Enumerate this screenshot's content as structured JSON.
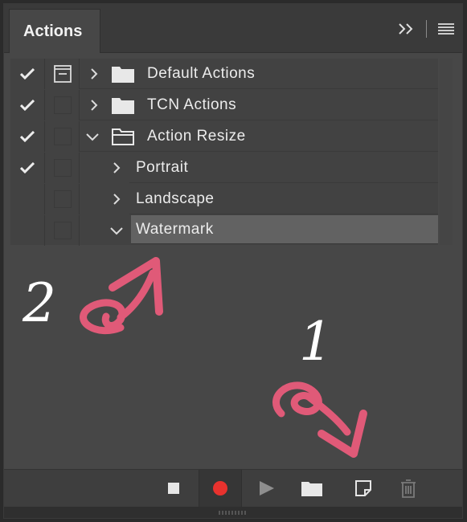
{
  "panel": {
    "tab_title": "Actions",
    "controls": {
      "collapse_icon": "double-chevron-right-icon",
      "menu_icon": "hamburger-menu-icon"
    }
  },
  "rows": [
    {
      "label": "Default Actions",
      "checked": true,
      "dialog": true,
      "expanded": false,
      "type": "set"
    },
    {
      "label": "TCN Actions",
      "checked": true,
      "dialog": false,
      "expanded": false,
      "type": "set"
    },
    {
      "label": "Action Resize",
      "checked": true,
      "dialog": false,
      "expanded": true,
      "type": "set"
    },
    {
      "label": "Portrait",
      "checked": true,
      "dialog": false,
      "expanded": false,
      "type": "action"
    },
    {
      "label": "Landscape",
      "checked": false,
      "dialog": false,
      "expanded": false,
      "type": "action"
    },
    {
      "label": "Watermark",
      "checked": false,
      "dialog": false,
      "expanded": true,
      "type": "action",
      "selected": true
    }
  ],
  "toolbar": {
    "buttons": [
      "stop-icon",
      "record-icon",
      "play-icon",
      "new-set-folder-icon",
      "new-action-icon",
      "trash-icon"
    ],
    "record_color": "#e8322e"
  },
  "annotations": {
    "label_1": "1",
    "label_2": "2",
    "arrow_color": "#e05a78"
  }
}
